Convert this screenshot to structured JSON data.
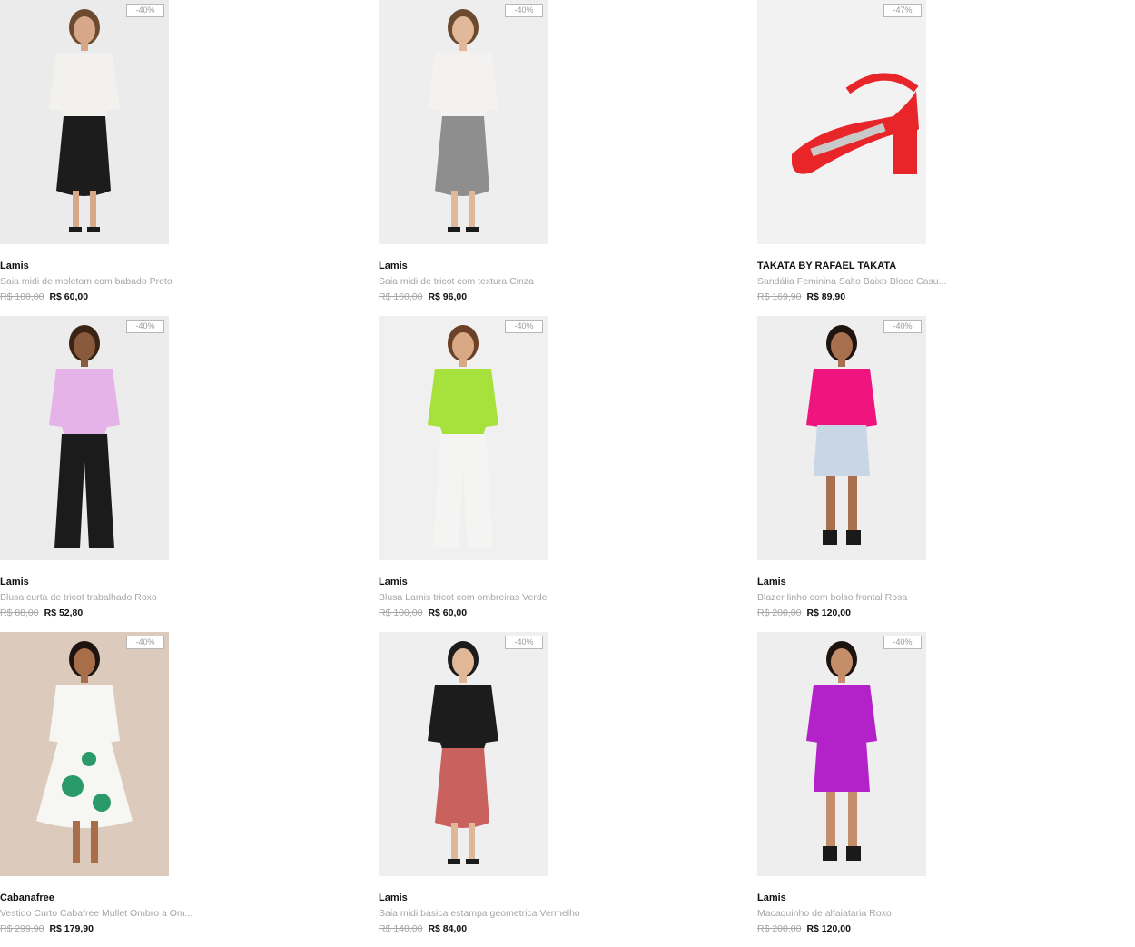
{
  "products": [
    {
      "brand": "Lamis",
      "name": "Saia midi de moletom com babado Preto",
      "old_price": "R$ 100,00",
      "price": "R$ 60,00",
      "discount": "-40%",
      "image": "black-ruffle-midi-skirt",
      "colors": {
        "bg": "#ebebeb",
        "top": "#f3f1ed",
        "bottom": "#1c1c1c",
        "skin": "#d7a789",
        "hair": "#6b4a30"
      }
    },
    {
      "brand": "Lamis",
      "name": "Saia midi de tricot com textura Cinza",
      "old_price": "R$ 160,00",
      "price": "R$ 96,00",
      "discount": "-40%",
      "image": "grey-knit-midi-skirt",
      "colors": {
        "bg": "#eeeeee",
        "top": "#f4f2f0",
        "bottom": "#8e8e8e",
        "skin": "#e1b899",
        "hair": "#6b4a30"
      }
    },
    {
      "brand": "TAKATA BY RAFAEL TAKATA",
      "name": "Sandália Feminina Salto Baixo Bloco Casu...",
      "old_price": "R$ 169,90",
      "price": "R$ 89,90",
      "discount": "-47%",
      "image": "red-block-heel-sandal",
      "colors": {
        "bg": "#f2f2f2",
        "top": "#e8262a",
        "bottom": "#c9c9c9",
        "skin": "#f2f2f2",
        "hair": "#f2f2f2"
      }
    },
    {
      "brand": "Lamis",
      "name": "Blusa curta de tricot trabalhado Roxo",
      "old_price": "R$ 88,00",
      "price": "R$ 52,80",
      "discount": "-40%",
      "image": "lilac-knit-crop-top",
      "colors": {
        "bg": "#ececec",
        "top": "#e6b3e8",
        "bottom": "#1b1b1b",
        "skin": "#8a5a3c",
        "hair": "#3b2416"
      }
    },
    {
      "brand": "Lamis",
      "name": "Blusa Lamis tricot com ombreiras Verde",
      "old_price": "R$ 100,00",
      "price": "R$ 60,00",
      "discount": "-40%",
      "image": "lime-knit-blouse",
      "colors": {
        "bg": "#f0f0f0",
        "top": "#a7e23c",
        "bottom": "#f4f4f2",
        "skin": "#d9a885",
        "hair": "#6b4128"
      }
    },
    {
      "brand": "Lamis",
      "name": "Blazer linho com bolso frontal Rosa",
      "old_price": "R$ 200,00",
      "price": "R$ 120,00",
      "discount": "-40%",
      "image": "pink-linen-blazer",
      "colors": {
        "bg": "#eeeeee",
        "top": "#f0157e",
        "bottom": "#c9d6e6",
        "skin": "#a8704e",
        "hair": "#1f1410"
      }
    },
    {
      "brand": "Cabanafree",
      "name": "Vestido Curto Cabafree Mullet Ombro a Om...",
      "old_price": "R$ 299,90",
      "price": "R$ 179,90",
      "discount": "-40%",
      "image": "green-print-dress",
      "colors": {
        "bg": "#dccbbc",
        "top": "#f6f7f3",
        "bottom": "#2a9a6a",
        "skin": "#a86d49",
        "hair": "#1d1410"
      }
    },
    {
      "brand": "Lamis",
      "name": "Saia midi basica estampa geometrica Vermelho",
      "old_price": "R$ 140,00",
      "price": "R$ 84,00",
      "discount": "-40%",
      "image": "red-geometric-midi-skirt",
      "colors": {
        "bg": "#efefef",
        "top": "#1c1c1c",
        "bottom": "#c9615e",
        "skin": "#e0b898",
        "hair": "#1c1c1c"
      }
    },
    {
      "brand": "Lamis",
      "name": "Macaquinho de alfaiataria Roxo",
      "old_price": "R$ 200,00",
      "price": "R$ 120,00",
      "discount": "-40%",
      "image": "purple-tailored-romper",
      "colors": {
        "bg": "#eeeeee",
        "top": "#b322c8",
        "bottom": "#b322c8",
        "skin": "#c58e6a",
        "hair": "#1d1410"
      }
    }
  ]
}
